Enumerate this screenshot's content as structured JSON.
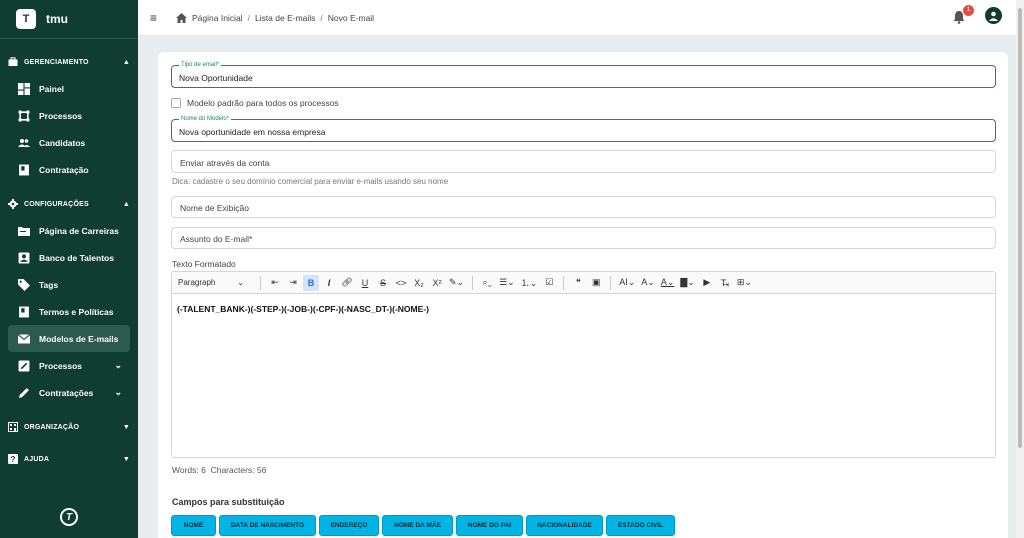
{
  "brand": {
    "logo_letter": "T",
    "name": "tmu"
  },
  "sidebar": {
    "sections": [
      {
        "label": "GERENCIAMENTO",
        "items": [
          {
            "label": "Painel",
            "icon": "dashboard-icon"
          },
          {
            "label": "Processos",
            "icon": "process-icon"
          },
          {
            "label": "Candidatos",
            "icon": "people-icon"
          },
          {
            "label": "Contratação",
            "icon": "contract-icon"
          }
        ]
      },
      {
        "label": "CONFIGURAÇÕES",
        "items": [
          {
            "label": "Página de Carreiras",
            "icon": "folder-icon"
          },
          {
            "label": "Banco de Talentos",
            "icon": "talent-icon"
          },
          {
            "label": "Tags",
            "icon": "tag-icon"
          },
          {
            "label": "Termos e Políticas",
            "icon": "document-icon"
          },
          {
            "label": "Modelos de E-mails",
            "icon": "mail-icon",
            "active": true
          },
          {
            "label": "Processos",
            "icon": "edit-icon"
          },
          {
            "label": "Contratações",
            "icon": "pen-icon"
          }
        ]
      },
      {
        "label": "ORGANIZAÇÃO"
      },
      {
        "label": "AJUDA"
      }
    ]
  },
  "breadcrumb": [
    "Página Inicial",
    "Lista de E-mails",
    "Novo E-mail"
  ],
  "notifications": {
    "count": "1"
  },
  "form": {
    "tipo_label": "Tipo de email*",
    "tipo_value": "Nova Oportunidade",
    "checkbox_label": "Modelo padrão para todos os processos",
    "nome_label": "Nome do Modelo*",
    "nome_value": "Nova oportunidade em nossa empresa",
    "conta_placeholder": "Enviar através da conta",
    "hint": "Dica: cadastre o seu domínio comercial para enviar e-mails usando seu nome",
    "exibicao_placeholder": "Nome de Exibição",
    "assunto_placeholder": "Assunto do E-mail*",
    "editor_label": "Texto Formatado",
    "paragraph_select": "Paragraph",
    "editor_content": "(-TALENT_BANK-)(-STEP-)(-JOB-)(-CPF-)(-NASC_DT-)(-NOME-)",
    "words": "Words: 6",
    "characters": "Characters: 56"
  },
  "substitution": {
    "title": "Campos para substituição",
    "chips": [
      "NOME",
      "DATA DE NASCIMENTO",
      "ENDEREÇO",
      "NOME DA MÃE",
      "NOME DO PAI",
      "NACIONALIDADE",
      "ESTADO CIVIL"
    ]
  },
  "colors": {
    "sidebar": "#0f3d31",
    "accent": "#17876b",
    "chip": "#00b4e6"
  }
}
